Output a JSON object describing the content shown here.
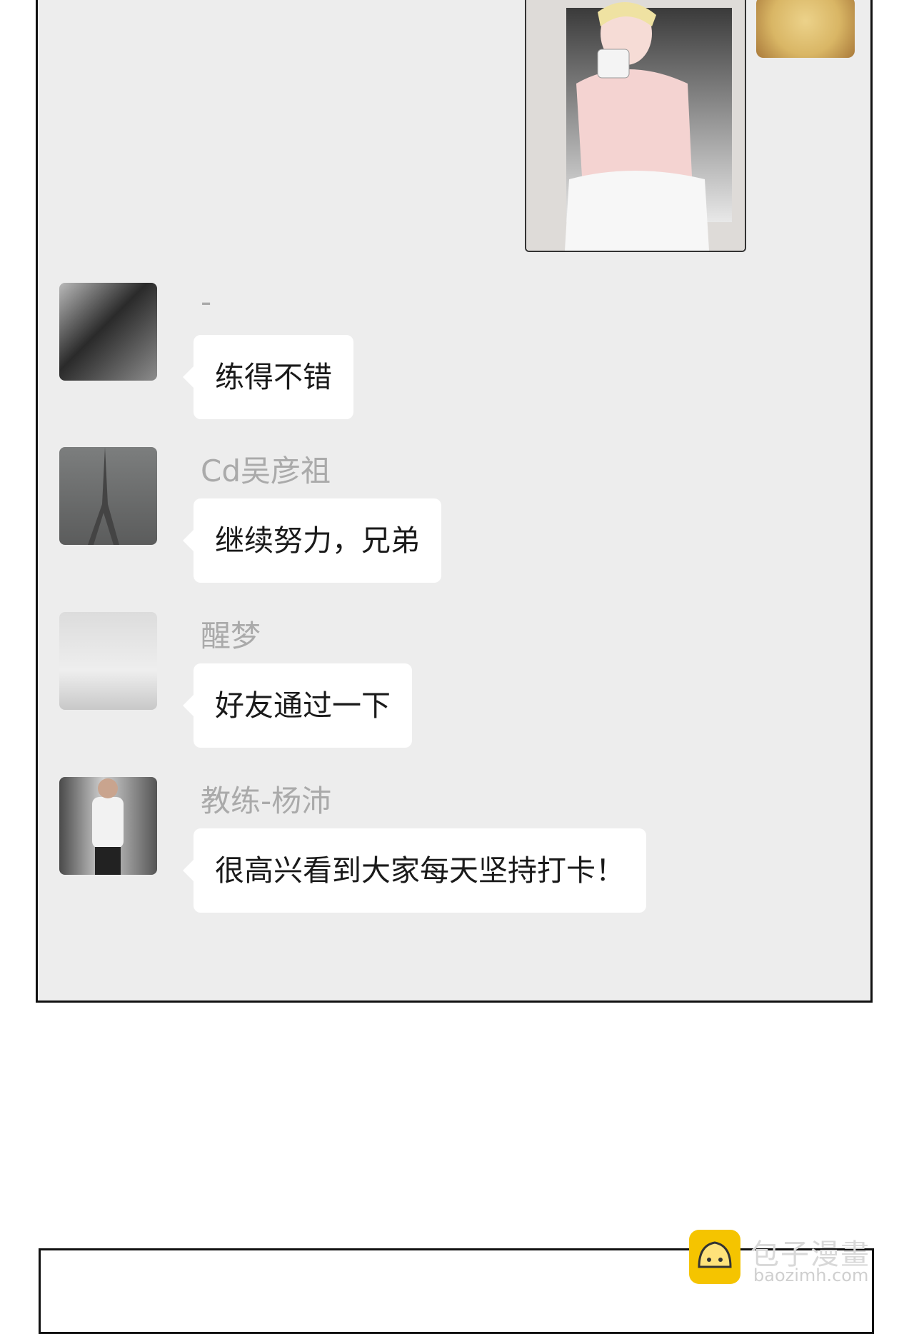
{
  "messages": [
    {
      "sender": "-",
      "text": "练得不错",
      "avatar": "camera-avatar"
    },
    {
      "sender": "Cd吴彦祖",
      "text": "继续努力，兄弟",
      "avatar": "foggy-tower-avatar"
    },
    {
      "sender": "醒梦",
      "text": "好友通过一下",
      "avatar": "bedroom-avatar"
    },
    {
      "sender": "教练-杨沛",
      "text": "很高兴看到大家每天坚持打卡！",
      "avatar": "gym-avatar"
    }
  ],
  "watermark": {
    "title": "包子漫畫",
    "url": "baozimh.com"
  },
  "colors": {
    "panel_bg": "#ededed",
    "bubble_bg": "#ffffff",
    "sender_text": "#aaaaaa",
    "logo_yellow": "#f5c400"
  }
}
